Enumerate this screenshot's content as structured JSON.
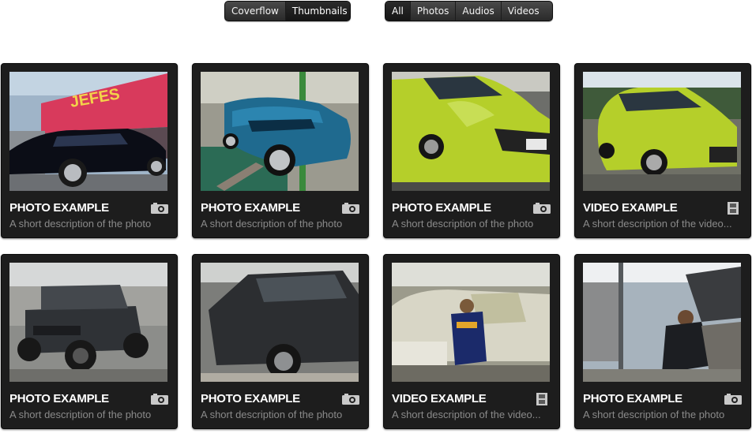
{
  "view_switch": {
    "options": [
      {
        "label": "Coverflow",
        "active": false
      },
      {
        "label": "Thumbnails",
        "active": true
      }
    ]
  },
  "filter_switch": {
    "options": [
      {
        "label": "All",
        "active": true
      },
      {
        "label": "Photos",
        "active": false
      },
      {
        "label": "Audios",
        "active": false
      },
      {
        "label": "Videos",
        "active": false
      }
    ]
  },
  "gallery": {
    "items": [
      {
        "title": "PHOTO EXAMPLE",
        "description": "A short description of the photo",
        "type": "photo",
        "icon": "camera-icon",
        "image": "black sedan parked in front of JEFES shop"
      },
      {
        "title": "PHOTO EXAMPLE",
        "description": "A short description of the photo",
        "type": "photo",
        "icon": "camera-icon",
        "image": "blue camaro convertible inside garage"
      },
      {
        "title": "PHOTO EXAMPLE",
        "description": "A short description of the photo",
        "type": "photo",
        "icon": "camera-icon",
        "image": "lime green hatchback with damaged front"
      },
      {
        "title": "VIDEO EXAMPLE",
        "description": "A short description of the video...",
        "type": "video",
        "icon": "film-icon",
        "image": "lime green hatchback parked outside"
      },
      {
        "title": "PHOTO EXAMPLE",
        "description": "A short description of the photo",
        "type": "photo",
        "icon": "camera-icon",
        "image": "dark jeep in paint shop"
      },
      {
        "title": "PHOTO EXAMPLE",
        "description": "A short description of the photo",
        "type": "photo",
        "icon": "camera-icon",
        "image": "dark SUV being prepared in garage"
      },
      {
        "title": "VIDEO EXAMPLE",
        "description": "A short description of the video...",
        "type": "video",
        "icon": "film-icon",
        "image": "worker masking a car in paint booth"
      },
      {
        "title": "PHOTO EXAMPLE",
        "description": "A short description of the photo",
        "type": "photo",
        "icon": "camera-icon",
        "image": "mechanic working on engine under hood"
      }
    ]
  },
  "colors": {
    "lime": "#b5cf2a",
    "blue_car": "#1f6a8f",
    "card_bg": "#1d1d1d",
    "desc_text": "#8a8a8a",
    "jefes_sign": "#d83a5c"
  }
}
